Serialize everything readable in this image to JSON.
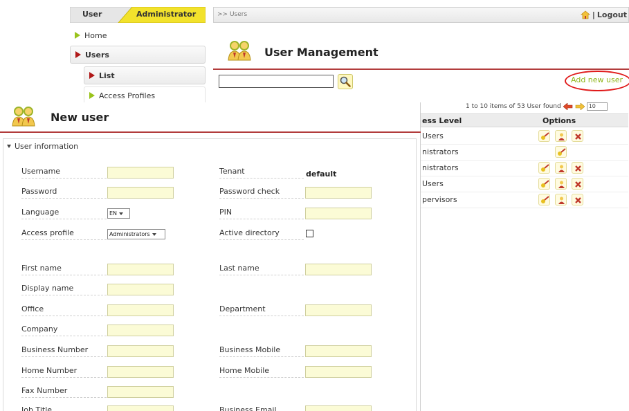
{
  "topnav": {
    "role_user": "User",
    "role_admin": "Administrator",
    "breadcrumb": ">> Users",
    "separator": "|",
    "logout": "Logout"
  },
  "sidebar": {
    "items": [
      {
        "label": "Home"
      },
      {
        "label": "Users"
      },
      {
        "label": "List"
      },
      {
        "label": "Access Profiles"
      }
    ]
  },
  "user_management": {
    "title": "User Management",
    "search_value": "",
    "add_new_user": "Add new user"
  },
  "pager": {
    "summary": "1 to 10 items of 53 User found",
    "page_size": "10"
  },
  "table": {
    "headers": {
      "level": "ess Level",
      "options": "Options"
    },
    "rows": [
      {
        "level": "Users"
      },
      {
        "level": "nistrators"
      },
      {
        "level": "nistrators"
      },
      {
        "level": "Users"
      },
      {
        "level": "pervisors"
      }
    ]
  },
  "modal": {
    "title": "New user",
    "section": "User information",
    "fields": {
      "username": "Username",
      "tenant": "Tenant",
      "tenant_value": "default",
      "password": "Password",
      "password_check": "Password check",
      "language": "Language",
      "language_value": "EN",
      "pin": "PIN",
      "access_profile": "Access profile",
      "access_profile_value": "Administrators",
      "active_directory": "Active directory",
      "first_name": "First name",
      "last_name": "Last name",
      "display_name": "Display name",
      "office": "Office",
      "department": "Department",
      "company": "Company",
      "business_number": "Business Number",
      "business_mobile": "Business Mobile",
      "home_number": "Home Number",
      "home_mobile": "Home Mobile",
      "fax_number": "Fax Number",
      "job_title": "Job Title",
      "business_email": "Business Email"
    }
  },
  "colors": {
    "accent_red": "#b23c3c",
    "accent_green": "#8fb51a",
    "input_fill": "#fbfbd6",
    "highlight_circle": "#e01b1b"
  }
}
